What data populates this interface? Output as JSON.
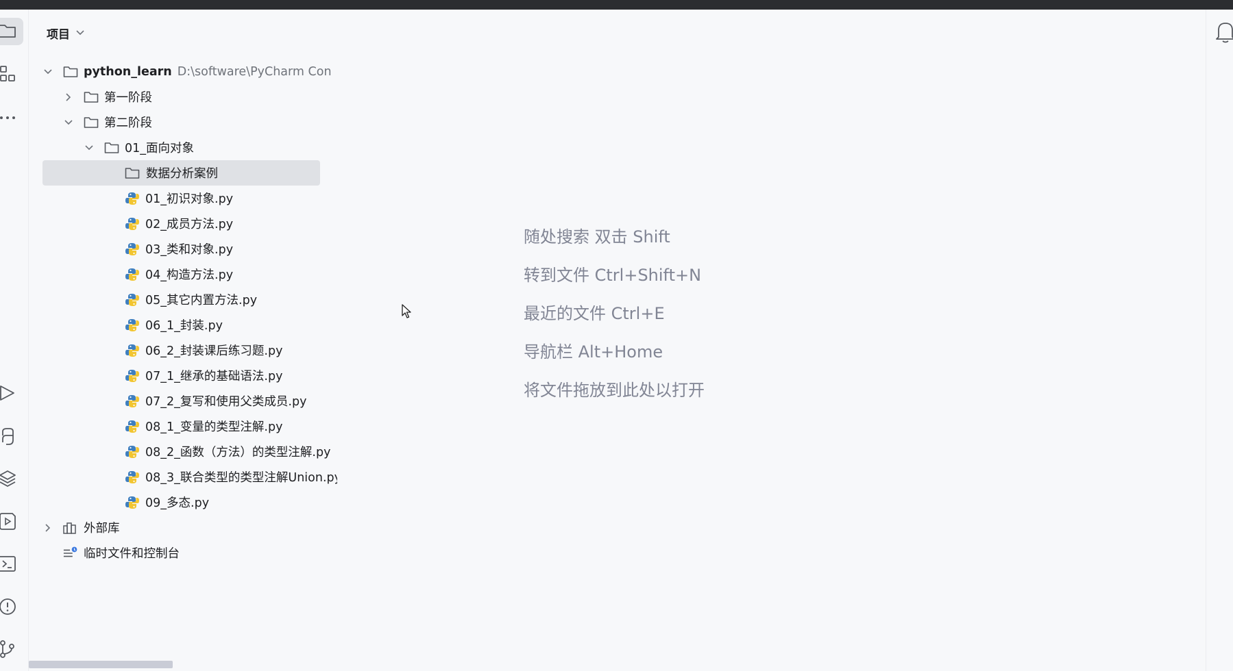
{
  "project_panel": {
    "title": "项目",
    "tree": [
      {
        "label": "python_learn",
        "path": "D:\\software\\PyCharm Con",
        "type": "folder",
        "expanded": true
      },
      {
        "label": "第一阶段",
        "type": "folder",
        "expanded": false
      },
      {
        "label": "第二阶段",
        "type": "folder",
        "expanded": true
      },
      {
        "label": "01_面向对象",
        "type": "folder",
        "expanded": true
      },
      {
        "label": "数据分析案例",
        "type": "folder",
        "selected": true
      },
      {
        "label": "01_初识对象.py",
        "type": "python"
      },
      {
        "label": "02_成员方法.py",
        "type": "python"
      },
      {
        "label": "03_类和对象.py",
        "type": "python"
      },
      {
        "label": "04_构造方法.py",
        "type": "python"
      },
      {
        "label": "05_其它内置方法.py",
        "type": "python"
      },
      {
        "label": "06_1_封装.py",
        "type": "python"
      },
      {
        "label": "06_2_封装课后练习题.py",
        "type": "python"
      },
      {
        "label": "07_1_继承的基础语法.py",
        "type": "python"
      },
      {
        "label": "07_2_复写和使用父类成员.py",
        "type": "python"
      },
      {
        "label": "08_1_变量的类型注解.py",
        "type": "python"
      },
      {
        "label": "08_2_函数（方法）的类型注解.py",
        "type": "python"
      },
      {
        "label": "08_3_联合类型的类型注解Union.py",
        "type": "python"
      },
      {
        "label": "09_多态.py",
        "type": "python"
      },
      {
        "label": "外部库",
        "type": "library",
        "expanded": false
      },
      {
        "label": "临时文件和控制台",
        "type": "scratch"
      }
    ]
  },
  "editor_hints": [
    "随处搜索 双击 Shift",
    "转到文件 Ctrl+Shift+N",
    "最近的文件 Ctrl+E",
    "导航栏 Alt+Home",
    "将文件拖放到此处以打开"
  ],
  "left_strip_icons": [
    "folder-icon",
    "structure-icon",
    "more-icon",
    "run-icon",
    "python-console-icon",
    "layers-icon",
    "services-icon",
    "terminal-icon",
    "problems-icon",
    "git-icon"
  ],
  "right_strip_icons": [
    "notifications-icon"
  ],
  "colors": {
    "background": "#f7f8fa",
    "selection": "#dfe1e5",
    "hint_text": "#818594",
    "path_text": "#6f737a",
    "titlebar": "#2b2d30"
  }
}
